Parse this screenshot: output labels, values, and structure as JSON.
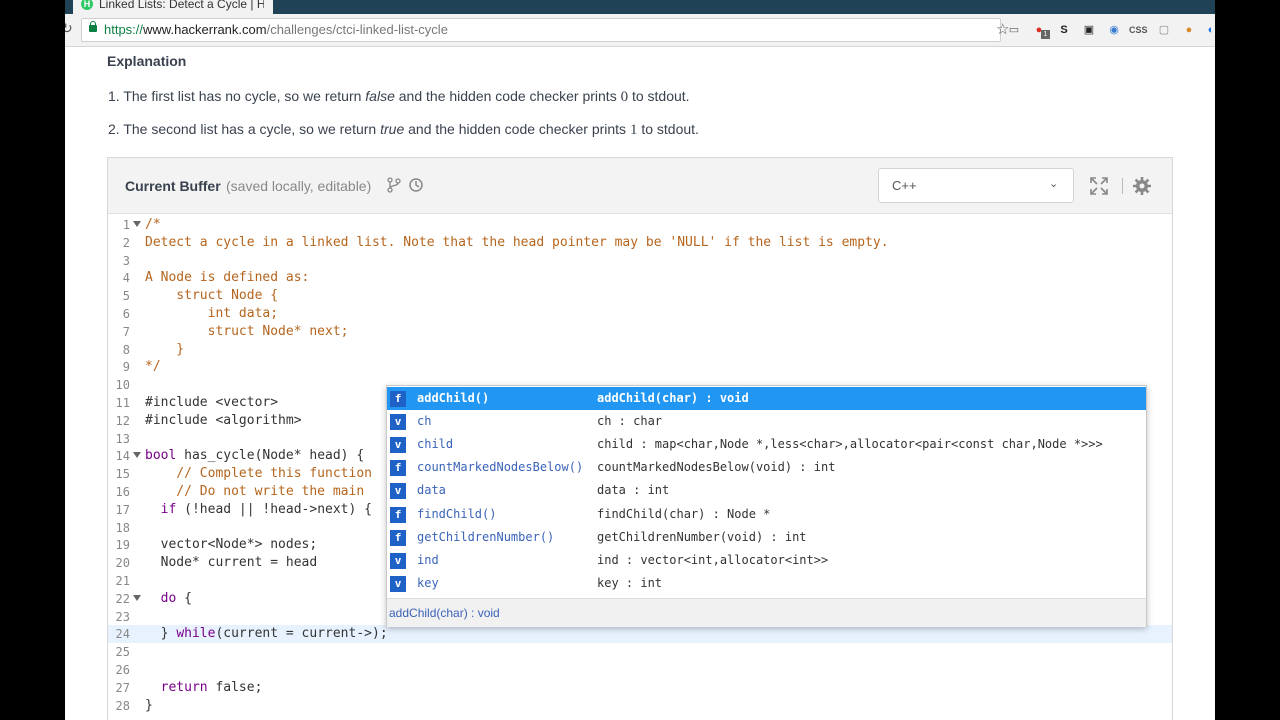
{
  "browser": {
    "tab_title": "Linked Lists: Detect a Cycle | H",
    "favicon": "H",
    "url_scheme": "https://",
    "url_host": "www.hackerrank.com",
    "url_path": "/challenges/ctci-linked-list-cycle",
    "extensions": [
      "cast-icon",
      "ext-red-icon",
      "ext-s-icon",
      "ext-car-icon",
      "ext-compass-icon",
      "css-icon",
      "ext-page-icon",
      "ext-cookie-icon",
      "ext-blue-icon"
    ],
    "ext_labels": {
      "css": "CSS",
      "badge": "1"
    }
  },
  "explanation": {
    "title": "Explanation",
    "item1": {
      "prefix": "1. The first list has no cycle, so we return ",
      "italic": "false",
      "mid": " and the hidden code checker prints ",
      "num": "0",
      "suffix": " to stdout."
    },
    "item2": {
      "prefix": "2. The second list has a cycle, so we return ",
      "italic": "true",
      "mid": " and the hidden code checker prints ",
      "num": "1",
      "suffix": " to stdout."
    }
  },
  "editor": {
    "title": "Current Buffer",
    "subtitle": "(saved locally, editable)",
    "language": "C++",
    "lines": [
      {
        "n": "1",
        "fold": true,
        "parts": [
          {
            "t": "/*",
            "c": "cm"
          }
        ]
      },
      {
        "n": "2",
        "parts": [
          {
            "t": "Detect a cycle in a linked list. Note that the head pointer may be 'NULL' if the list is empty.",
            "c": "cm"
          }
        ]
      },
      {
        "n": "3",
        "parts": []
      },
      {
        "n": "4",
        "parts": [
          {
            "t": "A Node is defined as:",
            "c": "cm"
          }
        ]
      },
      {
        "n": "5",
        "parts": [
          {
            "t": "    struct Node {",
            "c": "cm"
          }
        ]
      },
      {
        "n": "6",
        "parts": [
          {
            "t": "        int data;",
            "c": "cm"
          }
        ]
      },
      {
        "n": "7",
        "parts": [
          {
            "t": "        struct Node* next;",
            "c": "cm"
          }
        ]
      },
      {
        "n": "8",
        "parts": [
          {
            "t": "    }",
            "c": "cm"
          }
        ]
      },
      {
        "n": "9",
        "parts": [
          {
            "t": "*/",
            "c": "cm"
          }
        ]
      },
      {
        "n": "10",
        "parts": []
      },
      {
        "n": "11",
        "parts": [
          {
            "t": "#include <vector>",
            "c": ""
          }
        ]
      },
      {
        "n": "12",
        "parts": [
          {
            "t": "#include <algorithm>",
            "c": ""
          }
        ]
      },
      {
        "n": "13",
        "parts": []
      },
      {
        "n": "14",
        "fold": true,
        "parts": [
          {
            "t": "bool",
            "c": "kw"
          },
          {
            "t": " has_cycle(Node* head) {",
            "c": ""
          }
        ]
      },
      {
        "n": "15",
        "parts": [
          {
            "t": "    // Complete this function",
            "c": "cm"
          }
        ]
      },
      {
        "n": "16",
        "parts": [
          {
            "t": "    // Do not write the main",
            "c": "cm"
          }
        ]
      },
      {
        "n": "17",
        "parts": [
          {
            "t": "  ",
            "c": ""
          },
          {
            "t": "if",
            "c": "kw"
          },
          {
            "t": " (!head || !head->next) {",
            "c": ""
          }
        ]
      },
      {
        "n": "18",
        "parts": []
      },
      {
        "n": "19",
        "parts": [
          {
            "t": "  vector<Node*> nodes;",
            "c": ""
          }
        ]
      },
      {
        "n": "20",
        "parts": [
          {
            "t": "  Node* current = head",
            "c": ""
          }
        ]
      },
      {
        "n": "21",
        "parts": []
      },
      {
        "n": "22",
        "fold": true,
        "parts": [
          {
            "t": "  ",
            "c": ""
          },
          {
            "t": "do",
            "c": "kw"
          },
          {
            "t": " {",
            "c": ""
          }
        ]
      },
      {
        "n": "23",
        "parts": []
      },
      {
        "n": "24",
        "hl": true,
        "parts": [
          {
            "t": "  } ",
            "c": ""
          },
          {
            "t": "while",
            "c": "kw"
          },
          {
            "t": "(current = current->);",
            "c": ""
          }
        ]
      },
      {
        "n": "25",
        "parts": []
      },
      {
        "n": "26",
        "parts": []
      },
      {
        "n": "27",
        "parts": [
          {
            "t": "  ",
            "c": ""
          },
          {
            "t": "return",
            "c": "kw"
          },
          {
            "t": " false;",
            "c": ""
          }
        ]
      },
      {
        "n": "28",
        "parts": [
          {
            "t": "}",
            "c": ""
          }
        ]
      }
    ]
  },
  "autocomplete": {
    "items": [
      {
        "kind": "f",
        "name": "addChild()",
        "sig": "addChild(char) : void",
        "selected": true
      },
      {
        "kind": "v",
        "name": "ch",
        "sig": "ch : char"
      },
      {
        "kind": "v",
        "name": "child",
        "sig": "child : map<char,Node *,less<char>,allocator<pair<const char,Node *>>>"
      },
      {
        "kind": "f",
        "name": "countMarkedNodesBelow()",
        "sig": "countMarkedNodesBelow(void) : int"
      },
      {
        "kind": "v",
        "name": "data",
        "sig": "data : int"
      },
      {
        "kind": "f",
        "name": "findChild()",
        "sig": "findChild(char) : Node *"
      },
      {
        "kind": "f",
        "name": "getChildrenNumber()",
        "sig": "getChildrenNumber(void) : int"
      },
      {
        "kind": "v",
        "name": "ind",
        "sig": "ind : vector<int,allocator<int>>"
      },
      {
        "kind": "v",
        "name": "key",
        "sig": "key : int"
      }
    ],
    "footer": "addChild(char) : void"
  },
  "colors": {
    "accent": "#2196f3",
    "kind_badge": "#1e62c8",
    "comment": "#b5651d",
    "keyword": "#770088",
    "secure": "#0b8043"
  }
}
